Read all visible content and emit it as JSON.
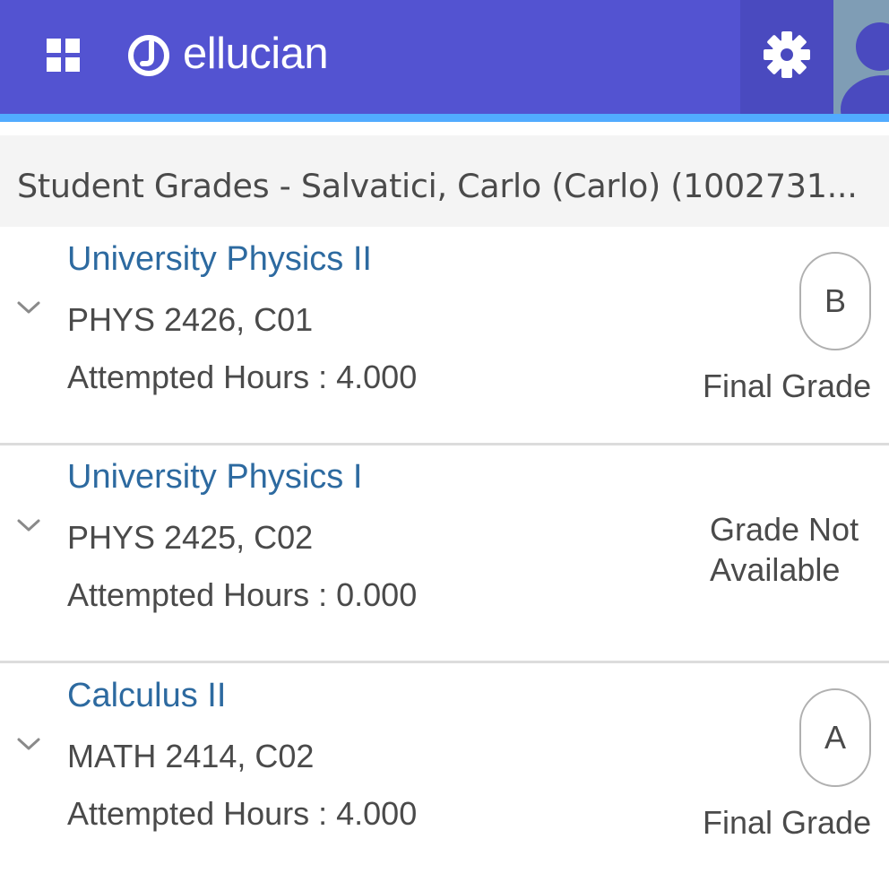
{
  "header": {
    "brand": "ellucian",
    "icons": {
      "apps": "apps-grid-icon",
      "logo": "ellucian-logo-icon",
      "settings": "gear-icon",
      "avatar": "user-avatar-icon"
    },
    "colors": {
      "bar": "#5353d1",
      "accent": "#51abff",
      "settings_bg": "#4a4abf",
      "avatar_bg": "#7f9db5"
    }
  },
  "page": {
    "title": "Student Grades - Salvatici, Carlo (Carlo) (1002731..."
  },
  "courses": [
    {
      "title": "University Physics II",
      "code": "PHYS 2426, C01",
      "hours": "Attempted Hours : 4.000",
      "grade": "B",
      "grade_label": "Final Grade"
    },
    {
      "title": "University Physics I",
      "code": "PHYS 2425, C02",
      "hours": "Attempted Hours : 0.000",
      "grade_status": "Grade Not Available"
    },
    {
      "title": "Calculus II",
      "code": "MATH 2414, C02",
      "hours": "Attempted Hours : 4.000",
      "grade": "A",
      "grade_label": "Final Grade"
    }
  ]
}
